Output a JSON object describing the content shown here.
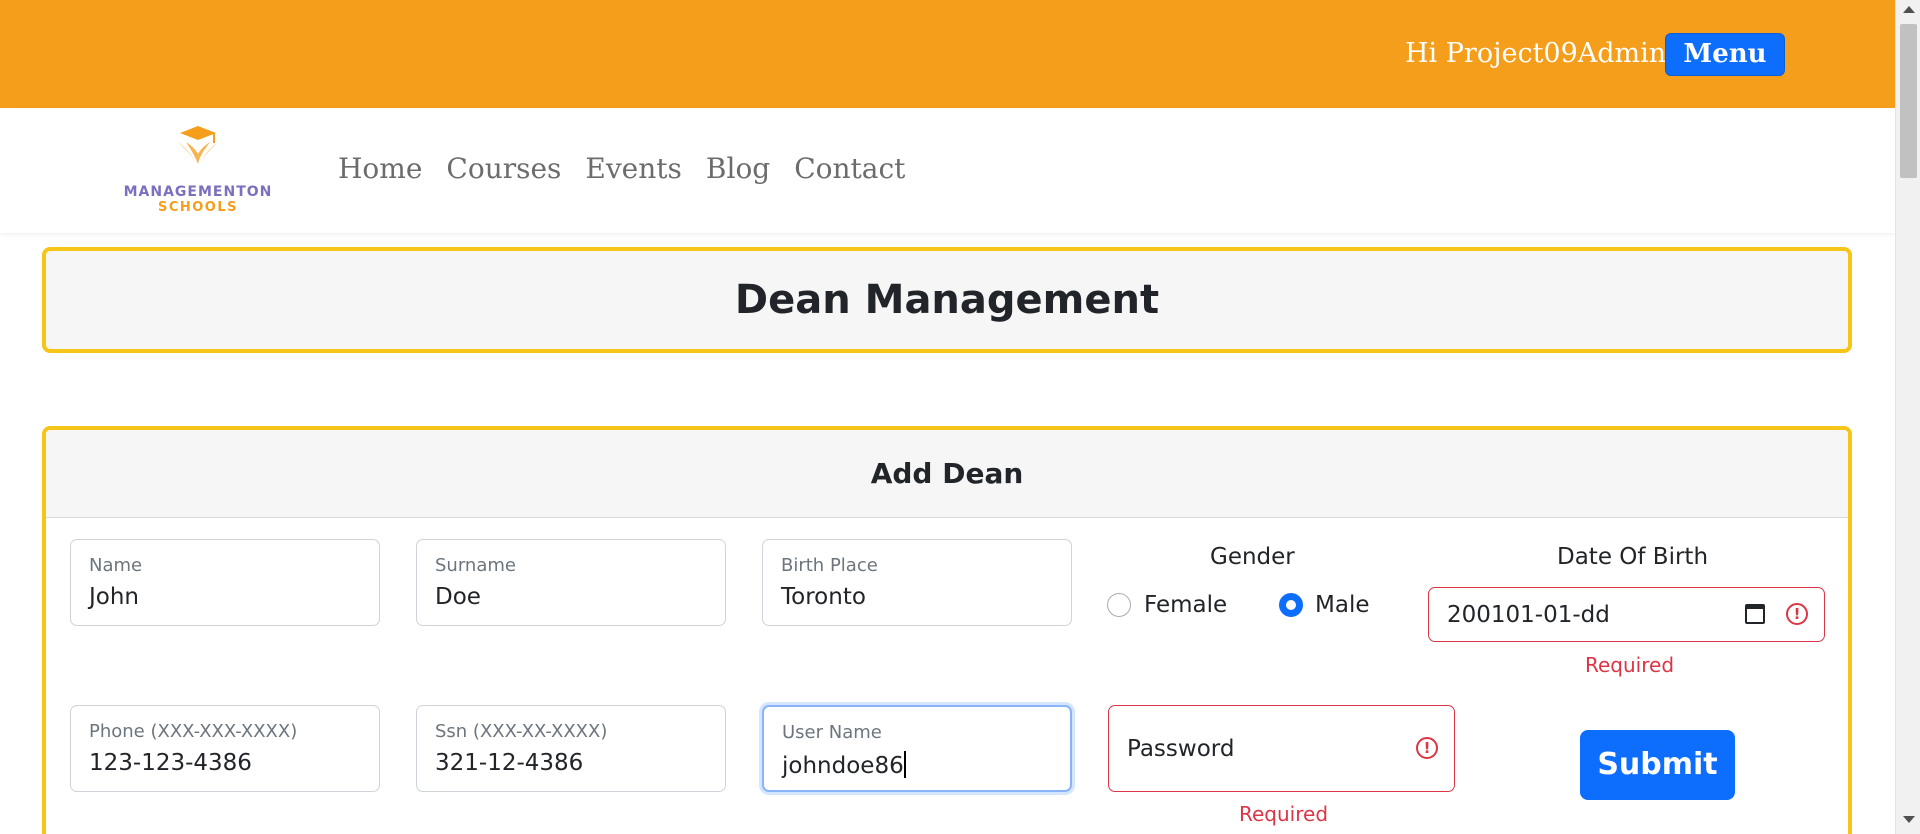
{
  "header": {
    "greeting": "Hi Project09Admin",
    "menu_label": "Menu",
    "bg_color": "#f49e1c"
  },
  "brand": {
    "logo_line1": "MANAGEMENTON",
    "logo_line2": "SCHOOLS"
  },
  "nav": {
    "items": [
      {
        "label": "Home"
      },
      {
        "label": "Courses"
      },
      {
        "label": "Events"
      },
      {
        "label": "Blog"
      },
      {
        "label": "Contact"
      }
    ]
  },
  "page": {
    "title": "Dean Management"
  },
  "form": {
    "title": "Add Dean",
    "name": {
      "label": "Name",
      "value": "John"
    },
    "surname": {
      "label": "Surname",
      "value": "Doe"
    },
    "birth_place": {
      "label": "Birth Place",
      "value": "Toronto"
    },
    "gender": {
      "label": "Gender",
      "options": [
        {
          "label": "Female",
          "selected": false
        },
        {
          "label": "Male",
          "selected": true
        }
      ]
    },
    "date_of_birth": {
      "label": "Date Of Birth",
      "value": "200101-01-dd",
      "error": "Required"
    },
    "phone": {
      "label": "Phone (XXX-XXX-XXXX)",
      "value": "123-123-4386"
    },
    "ssn": {
      "label": "Ssn (XXX-XX-XXXX)",
      "value": "321-12-4386"
    },
    "username": {
      "label": "User Name",
      "value": "johndoe86"
    },
    "password": {
      "placeholder": "Password",
      "error": "Required"
    },
    "submit_label": "Submit"
  },
  "colors": {
    "accent_orange": "#f49e1c",
    "card_border": "#f5c518",
    "primary_blue": "#0d6efd",
    "error_red": "#dc3545"
  }
}
